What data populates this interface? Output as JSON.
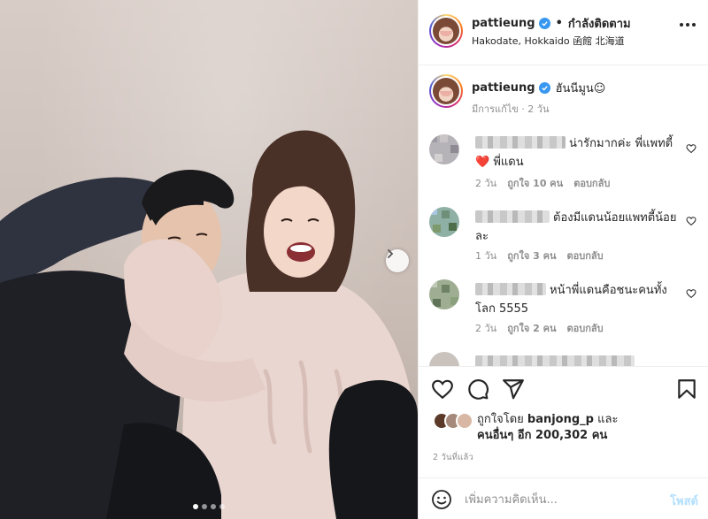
{
  "post": {
    "author": "pattieung",
    "follow_separator": "•",
    "follow_state": "กำลังติดตาม",
    "location": "Hakodate, Hokkaido 函館 北海道",
    "caption_text": "ฮันนีมูน☺",
    "caption_meta": "มีการแก้ไข · 2 วัน",
    "carousel": {
      "total": 4,
      "active": 1
    }
  },
  "comments": [
    {
      "text": "น่ารักมากค่ะ พี่แพทตี้❤️ พี่แดน",
      "time": "2 วัน",
      "likes": "ถูกใจ 10 คน",
      "reply": "ตอบกลับ"
    },
    {
      "text": "ต้องมีแดนน้อยแพทตี้น้อยละ",
      "time": "1 วัน",
      "likes": "ถูกใจ 3 คน",
      "reply": "ตอบกลับ"
    },
    {
      "text": "หน้าพี่แดนคือชนะคนทั้งโลก 5555",
      "time": "2 วัน",
      "likes": "ถูกใจ 2 คน",
      "reply": "ตอบกลับ"
    }
  ],
  "likes": {
    "prefix": "ถูกใจโดย",
    "first_user": "banjong_p",
    "and": "และ",
    "others": "คนอื่นๆ อีก 200,302 คน"
  },
  "posted_ago": "2 วันที่แล้ว",
  "comment_box": {
    "placeholder": "เพิ่มความคิดเห็น...",
    "post_label": "โพสต์"
  },
  "icons": {
    "heart": "heart-icon",
    "comment": "comment-icon",
    "share": "paper-plane-icon",
    "save": "bookmark-icon",
    "emoji": "smiley-icon",
    "more": "ellipsis-icon",
    "next": "chevron-right-icon",
    "verified": "verified-badge-icon"
  },
  "colors": {
    "verified": "#3897f0",
    "post_button_disabled": "#b2dffc",
    "muted_text": "#8e8e8e",
    "heart_emoji": "#ed1c24"
  }
}
